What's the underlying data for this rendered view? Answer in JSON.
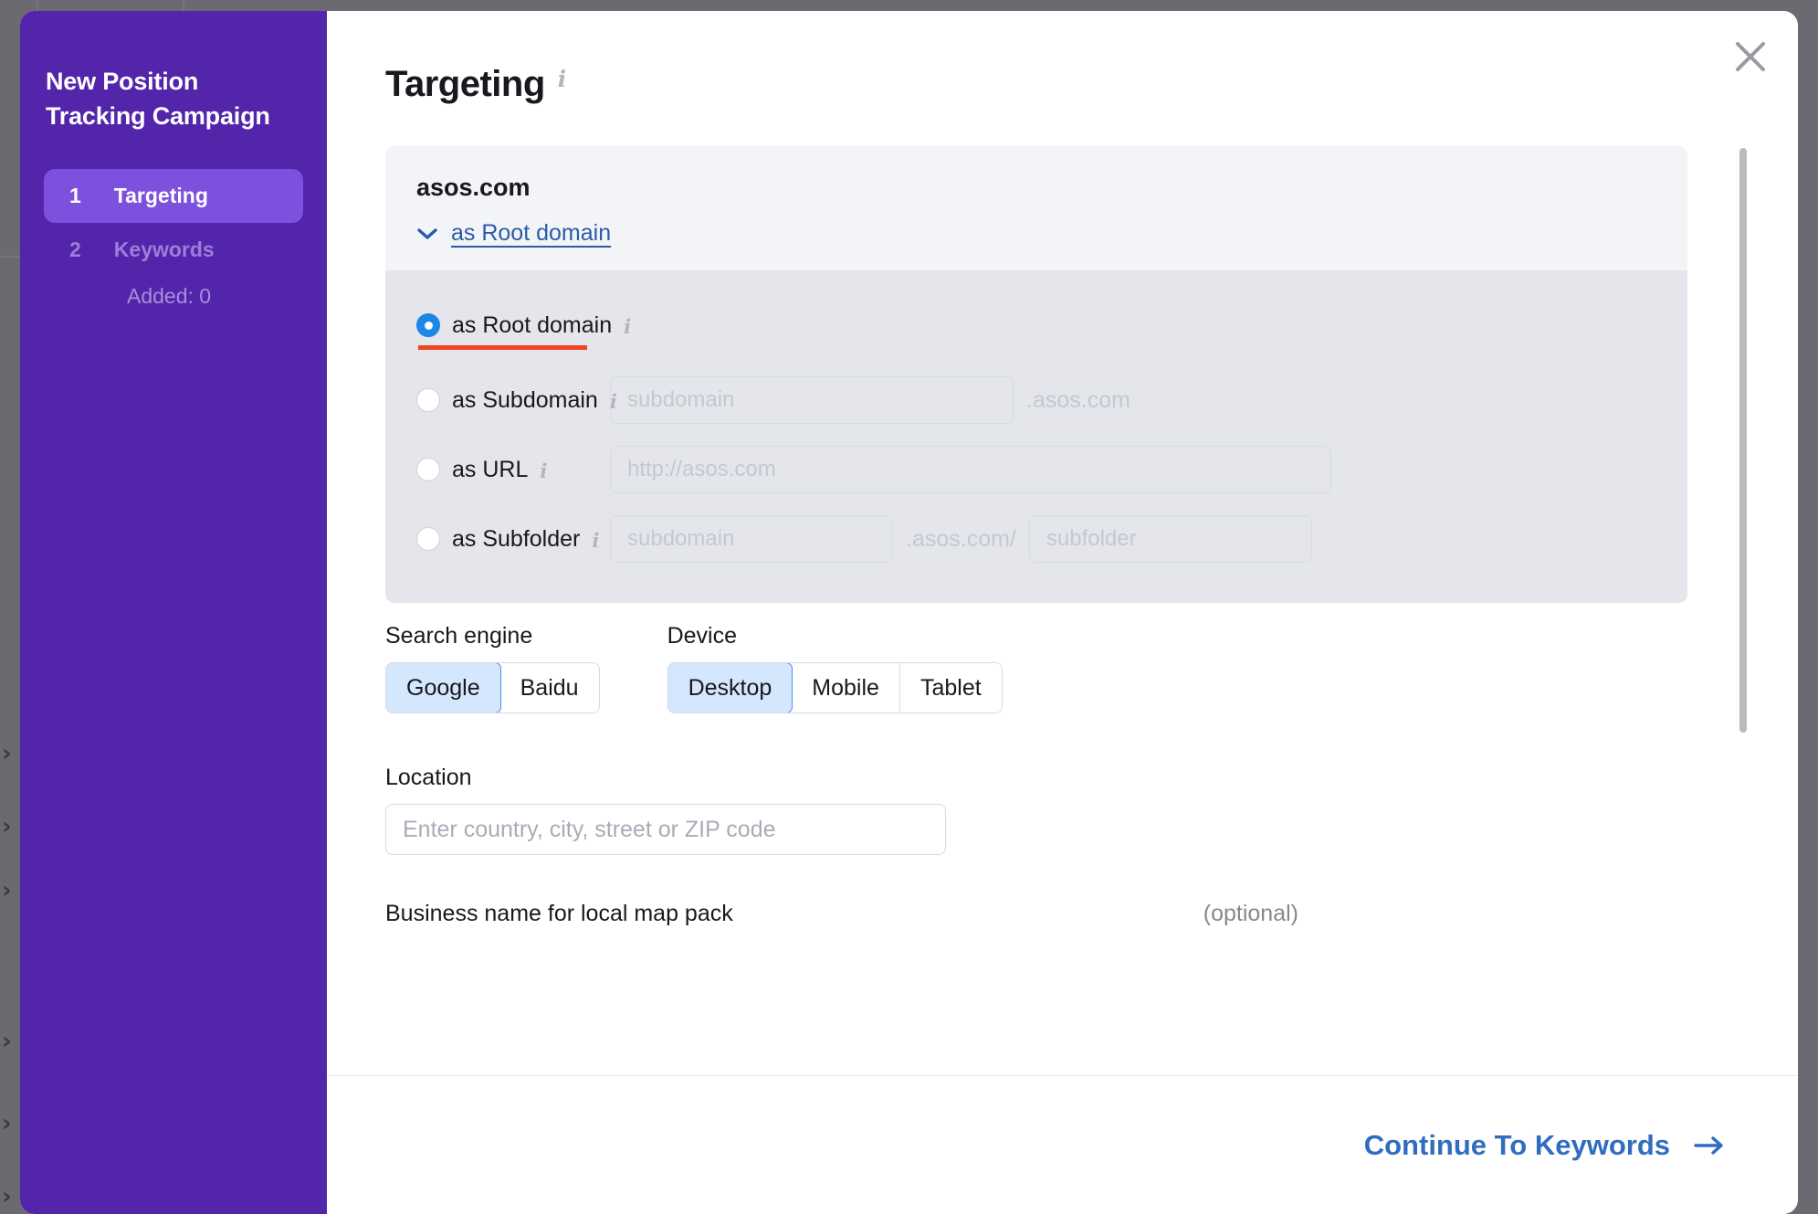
{
  "sidebar": {
    "title": "New Position Tracking Campaign",
    "steps": [
      {
        "num": "1",
        "label": "Targeting",
        "sub": null
      },
      {
        "num": "2",
        "label": "Keywords",
        "sub": "Added: 0"
      }
    ]
  },
  "header": {
    "title": "Targeting",
    "info_icon": "info-icon",
    "close_icon": "close-icon"
  },
  "domain_card": {
    "domain": "asos.com",
    "selected_mode_label": "as Root domain",
    "chevron_icon": "chevron-down-icon",
    "options": [
      {
        "label": "as Root domain",
        "selected": true,
        "inputs": []
      },
      {
        "label": "as Subdomain",
        "selected": false,
        "inputs": [
          {
            "placeholder": "subdomain"
          }
        ],
        "suffix": ".asos.com"
      },
      {
        "label": "as URL",
        "selected": false,
        "inputs": [
          {
            "placeholder": "http://asos.com"
          }
        ]
      },
      {
        "label": "as Subfolder",
        "selected": false,
        "inputs": [
          {
            "placeholder": "subdomain"
          },
          {
            "placeholder": "subfolder"
          }
        ],
        "suffix": ".asos.com/"
      }
    ]
  },
  "form": {
    "search_engine": {
      "label": "Search engine",
      "options": [
        "Google",
        "Baidu"
      ],
      "selected": "Google"
    },
    "device": {
      "label": "Device",
      "options": [
        "Desktop",
        "Mobile",
        "Tablet"
      ],
      "selected": "Desktop"
    },
    "location": {
      "label": "Location",
      "value": "",
      "placeholder": "Enter country, city, street or ZIP code"
    },
    "business": {
      "label": "Business name for local map pack",
      "optional": "(optional)"
    }
  },
  "footer": {
    "continue_label": "Continue To Keywords",
    "arrow_icon": "arrow-right-icon"
  },
  "colors": {
    "sidebar_purple": "#5225ab",
    "step_active_purple": "#7d51dd",
    "link_blue": "#2a5caa",
    "accent_blue": "#1b87e6",
    "selected_seg_bg": "#d4e7fd",
    "selected_seg_border": "#4a90e8",
    "highlight_red": "#f04522",
    "card_bg": "#f3f4f8",
    "radio_panel_bg": "#e4e6eb",
    "backdrop": "#6a6a70"
  }
}
